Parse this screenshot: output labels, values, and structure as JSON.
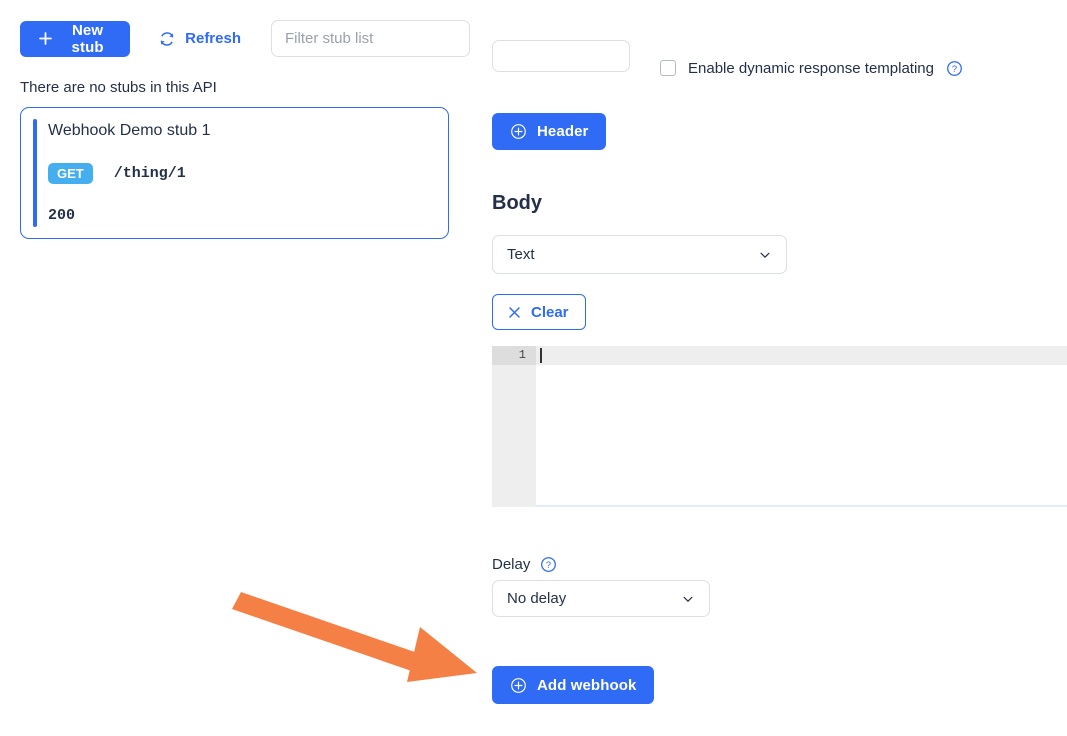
{
  "left_panel": {
    "toolbar": {
      "new_stub_label": "New stub",
      "refresh_label": "Refresh",
      "filter_placeholder": "Filter stub list",
      "filter_value": ""
    },
    "empty_message": "There are no stubs in this API",
    "stub_card": {
      "title": "Webhook Demo stub 1",
      "method": "GET",
      "path": "/thing/1",
      "status": "200"
    }
  },
  "right_panel": {
    "templating_label": "Enable dynamic response templating",
    "header_button_label": "Header",
    "body_heading": "Body",
    "body_type_value": "Text",
    "body_type_options": [
      "Text"
    ],
    "clear_label": "Clear",
    "editor": {
      "line_number": "1",
      "content": ""
    },
    "delay_label": "Delay",
    "delay_value": "No delay",
    "delay_options": [
      "No delay"
    ],
    "add_webhook_label": "Add webhook"
  },
  "colors": {
    "primary_blue": "#2f6bf5",
    "method_get_blue": "#45aeee",
    "annotation_orange": "#f58045",
    "text_dark": "#24304a",
    "border_grey": "#dcdfe4"
  }
}
